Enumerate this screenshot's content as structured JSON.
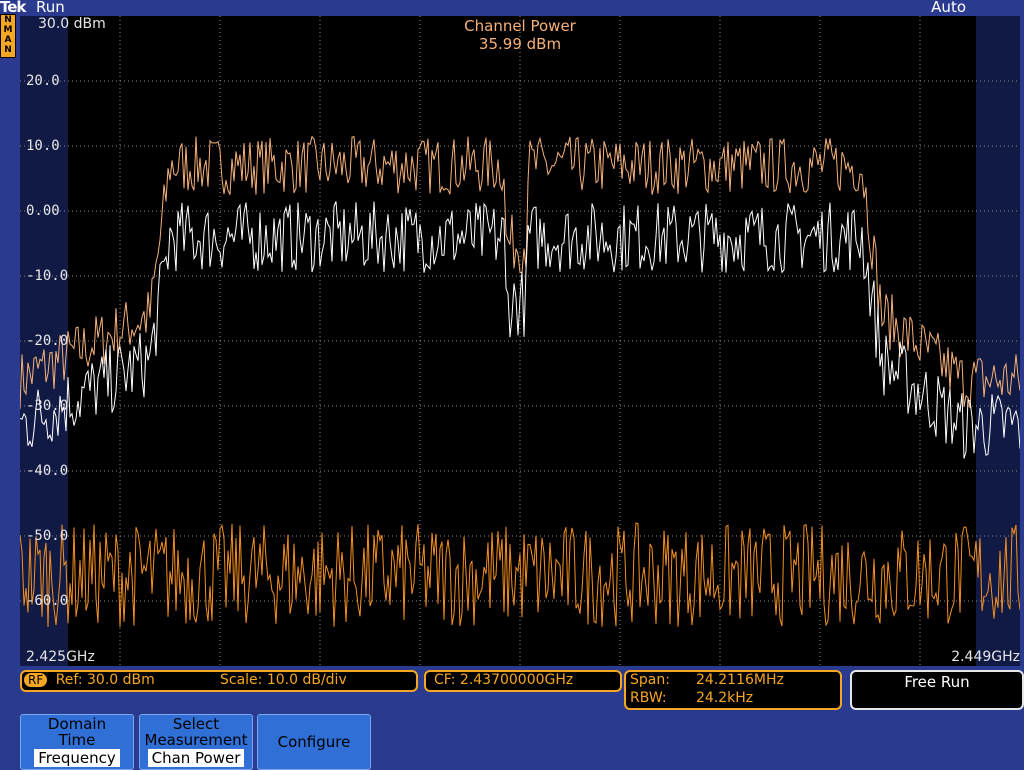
{
  "header": {
    "logo": "Tek",
    "run_status": "Run",
    "trigger_mode": "Auto",
    "trace_mode_letters": [
      "N",
      "M",
      "A",
      "N"
    ]
  },
  "display": {
    "ref_label": "30.0 dBm",
    "measurement_title": "Channel Power",
    "measurement_value": "35.99 dBm",
    "y_labels": [
      "20.0",
      "10.0",
      "0.00",
      "-10.0",
      "-20.0",
      "-30.0",
      "-40.0",
      "-50.0",
      "-60.0"
    ],
    "x_start": "2.425GHz",
    "x_stop": "2.449GHz"
  },
  "status_bar": {
    "rf_badge": "RF",
    "ref": "Ref: 30.0 dBm",
    "scale": "Scale: 10.0 dB/div",
    "cf": "CF:  2.43700000GHz",
    "span_label": "Span:",
    "span_value": "24.2116MHz",
    "rbw_label": "RBW:",
    "rbw_value": "24.2kHz",
    "free_run": "Free Run"
  },
  "softkeys": [
    {
      "line1": "Domain",
      "line2": "Time",
      "selected": "Frequency"
    },
    {
      "line1": "Select",
      "line2": "Measurement",
      "selected": "Chan Power"
    },
    {
      "line1": "Configure",
      "line2": "",
      "selected": ""
    }
  ],
  "colors": {
    "background": "#2a3a8e",
    "trace_peak": "#f6b27a",
    "trace_normal": "#ffffff",
    "trace_noise": "#f5901e",
    "accent": "#f5a623"
  }
}
